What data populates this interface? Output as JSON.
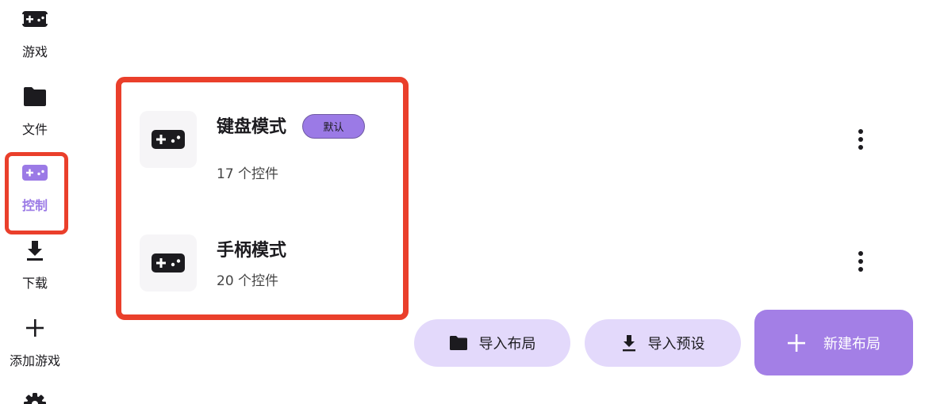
{
  "nav": {
    "items": [
      {
        "label": "游戏",
        "icon": "gamepad-icon"
      },
      {
        "label": "文件",
        "icon": "folder-icon"
      },
      {
        "label": "控制",
        "icon": "gamepad-icon",
        "active": true
      },
      {
        "label": "下载",
        "icon": "download-icon"
      },
      {
        "label": "添加游戏",
        "icon": "plus-icon"
      },
      {
        "label": "",
        "icon": "gear-icon"
      }
    ]
  },
  "layouts": [
    {
      "name": "键盘模式",
      "badge": "默认",
      "count": "17 个控件",
      "icon": "gamepad-icon"
    },
    {
      "name": "手柄模式",
      "count": "20 个控件",
      "icon": "gamepad-icon"
    }
  ],
  "actions": {
    "import_layout": "导入布局",
    "import_preset": "导入预设",
    "new_layout": "新建布局"
  },
  "colors": {
    "accent": "#9b7ae6",
    "primary_button": "#a37fe6",
    "tonal_button": "#e3d9fb",
    "highlight": "#ea3f2b"
  }
}
